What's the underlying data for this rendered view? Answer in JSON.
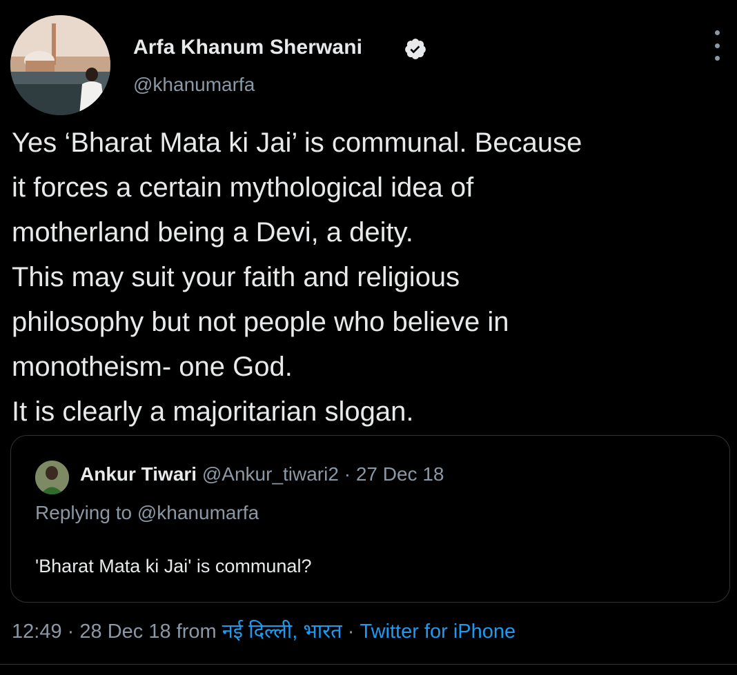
{
  "author": {
    "name": "Arfa Khanum Sherwani",
    "handle": "@khanumarfa",
    "verified": true
  },
  "tweet": {
    "lines": [
      "Yes ‘Bharat Mata ki Jai’ is communal. Because",
      "it forces a certain mythological idea of",
      "motherland being a Devi, a deity.",
      "This may suit your faith and religious",
      "philosophy but not people who believe in",
      "monotheism- one God.",
      "It is clearly a majoritarian slogan."
    ]
  },
  "quote": {
    "name": "Ankur Tiwari",
    "handle": "@Ankur_tiwari2",
    "separator": "·",
    "date": "27 Dec 18",
    "replying_to": "Replying to @khanumarfa",
    "text": "'Bharat Mata ki Jai' is communal?"
  },
  "footer": {
    "time": "12:49",
    "separator": "·",
    "date": "28 Dec 18",
    "from_label": "from",
    "location": "नई दिल्ली, भारत",
    "source": "Twitter for iPhone"
  },
  "colors": {
    "background": "#000000",
    "text": "#e7e9ea",
    "secondary": "#8b98a5",
    "link": "#1d9bf0",
    "border": "#2f3336"
  },
  "icons": [
    "verified-badge-icon",
    "more-options-icon"
  ]
}
